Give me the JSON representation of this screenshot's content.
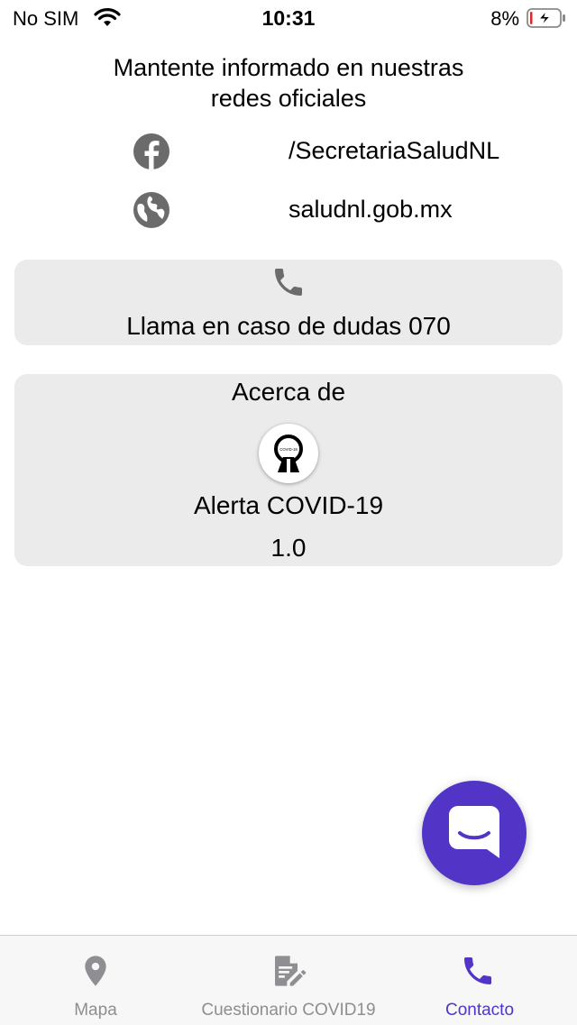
{
  "status_bar": {
    "carrier": "No SIM",
    "time": "10:31",
    "battery_percent": "8%",
    "battery_level": 0.08,
    "charging": true
  },
  "intro": {
    "line1": "Mantente informado en nuestras",
    "line2": "redes oficiales"
  },
  "social": {
    "facebook": {
      "icon": "facebook-icon",
      "text": "/SecretariaSaludNL"
    },
    "website": {
      "icon": "globe-icon",
      "text": "saludnl.gob.mx"
    }
  },
  "call_card": {
    "icon": "phone-icon",
    "label": "Llama en caso de dudas 070"
  },
  "about_card": {
    "title": "Acerca de",
    "logo_icon": "app-logo-icon",
    "logo_text": "COVID-19",
    "app_name": "Alerta COVID-19",
    "version": "1.0"
  },
  "chat_button": {
    "icon": "chat-bubble-icon"
  },
  "tab_bar": {
    "tabs": [
      {
        "label": "Mapa",
        "icon": "map-pin-icon",
        "selected": false
      },
      {
        "label": "Cuestionario COVID19",
        "icon": "form-edit-icon",
        "selected": false
      },
      {
        "label": "Contacto",
        "icon": "phone-icon",
        "selected": true
      }
    ]
  },
  "colors": {
    "accent": "#5235c7",
    "card_background": "#ebebeb",
    "icon_gray": "#6b6b6b",
    "tab_inactive": "#8e8e93",
    "battery_low": "#e0262b"
  }
}
